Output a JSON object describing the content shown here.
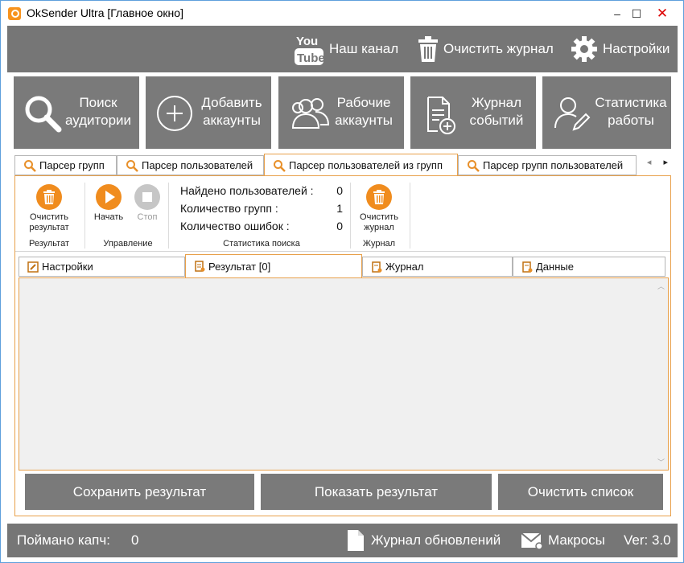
{
  "window": {
    "title": "OkSender Ultra [Главное окно]",
    "controls": {
      "minimize": "–",
      "maximize": "☐",
      "close": "✕"
    }
  },
  "topbar": {
    "youtube_label": "Наш канал",
    "clear_log_label": "Очистить журнал",
    "settings_label": "Настройки"
  },
  "main_buttons": [
    {
      "line1": "Поиск",
      "line2": "аудитории",
      "icon": "search-icon"
    },
    {
      "line1": "Добавить",
      "line2": "аккаунты",
      "icon": "plus-circle-icon"
    },
    {
      "line1": "Рабочие",
      "line2": "аккаунты",
      "icon": "users-icon"
    },
    {
      "line1": "Журнал",
      "line2": "событий",
      "icon": "document-add-icon"
    },
    {
      "line1": "Статистика",
      "line2": "работы",
      "icon": "user-edit-icon"
    }
  ],
  "tabs": [
    {
      "label": "Парсер групп"
    },
    {
      "label": "Парсер пользователей"
    },
    {
      "label": "Парсер пользователей из групп"
    },
    {
      "label": "Парсер групп пользователей"
    }
  ],
  "tab_scroll": {
    "left": "◂",
    "right": "▸"
  },
  "ribbon": {
    "clear_result": {
      "line1": "Очистить",
      "line2": "результат"
    },
    "group_result": "Результат",
    "start": "Начать",
    "stop": "Стоп",
    "group_control": "Управление",
    "stats": [
      {
        "label": "Найдено пользователей :",
        "value": "0"
      },
      {
        "label": "Количество групп :",
        "value": "1"
      },
      {
        "label": "Количество ошибок :",
        "value": "0"
      }
    ],
    "group_stats": "Статистика поиска",
    "clear_journal": {
      "line1": "Очистить",
      "line2": "журнал"
    },
    "group_journal": "Журнал"
  },
  "inner_tabs": [
    {
      "label": "Настройки"
    },
    {
      "label": "Результат [0]"
    },
    {
      "label": "Журнал"
    },
    {
      "label": "Данные"
    }
  ],
  "bottom_buttons": {
    "save": "Сохранить результат",
    "show": "Показать результат",
    "clear": "Очистить список"
  },
  "statusbar": {
    "captcha_label": "Поймано капч:",
    "captcha_value": "0",
    "updates_label": "Журнал обновлений",
    "macros_label": "Макросы",
    "version": "Ver: 3.0"
  },
  "colors": {
    "accent_orange": "#f08c1e",
    "tile_grey": "#7a7a7a",
    "bar_grey": "#767676",
    "active_border": "#e8a04a"
  }
}
